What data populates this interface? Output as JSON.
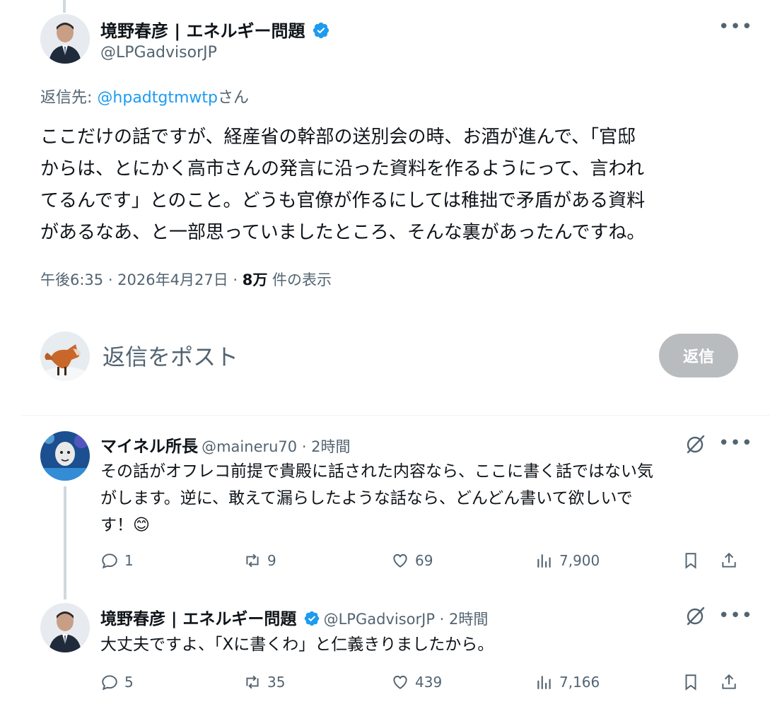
{
  "main_post": {
    "author_name": "境野春彦 | エネルギー問題",
    "author_handle": "@LPGadvisorJP",
    "reply_prefix": "返信先: ",
    "reply_to": "@hpadtgtmwtp",
    "reply_suffix": "さん",
    "text_lines": [
      "ここだけの話ですが、経産省の幹部の送別会の時、お酒が進んで、「官邸",
      "からは、とにかく高市さんの発言に沿った資料を作るようにって、言われ",
      "てるんです」とのこと。どうも官僚が作るにしては稚拙で矛盾がある資料",
      "があるなあ、と一部思っていましたところ、そんな裏があったんですね。"
    ],
    "timestamp": "午後6:35 · 2026年4月27日 · ",
    "views_count": "8万",
    "views_label": " 件の表示"
  },
  "reply_composer": {
    "placeholder": "返信をポスト",
    "button_label": "返信"
  },
  "replies": [
    {
      "author_name": "マイネル所長",
      "author_handle": "@maineru70",
      "time": " · 2時間",
      "text_lines": [
        "その話がオフレコ前提で貴殿に話された内容なら、ここに書く話ではない気",
        "がします。逆に、敢えて漏らしたような話なら、どんどん書いて欲しいで",
        "す！"
      ],
      "emoji": "😊",
      "replies": "1",
      "reposts": "9",
      "likes": "69",
      "views": "7,900"
    },
    {
      "author_name": "境野春彦 | エネルギー問題",
      "author_handle": "@LPGadvisorJP",
      "time": " · 2時間",
      "text_lines": [
        "大丈夫ですよ、「Xに書くわ」と仁義きりましたから。"
      ],
      "replies": "5",
      "reposts": "35",
      "likes": "439",
      "views": "7,166"
    }
  ],
  "icons": {
    "verified": "verified-badge-icon",
    "more": "more-icon",
    "reply": "reply-icon",
    "repost": "repost-icon",
    "like": "like-icon",
    "views": "views-icon",
    "bookmark": "bookmark-icon",
    "share": "share-icon",
    "grok": "grok-icon"
  },
  "colors": {
    "link": "#1d9bf0",
    "secondary": "#536471",
    "verified": "#1d9bf0",
    "reply_button": "#b9bcbf"
  }
}
